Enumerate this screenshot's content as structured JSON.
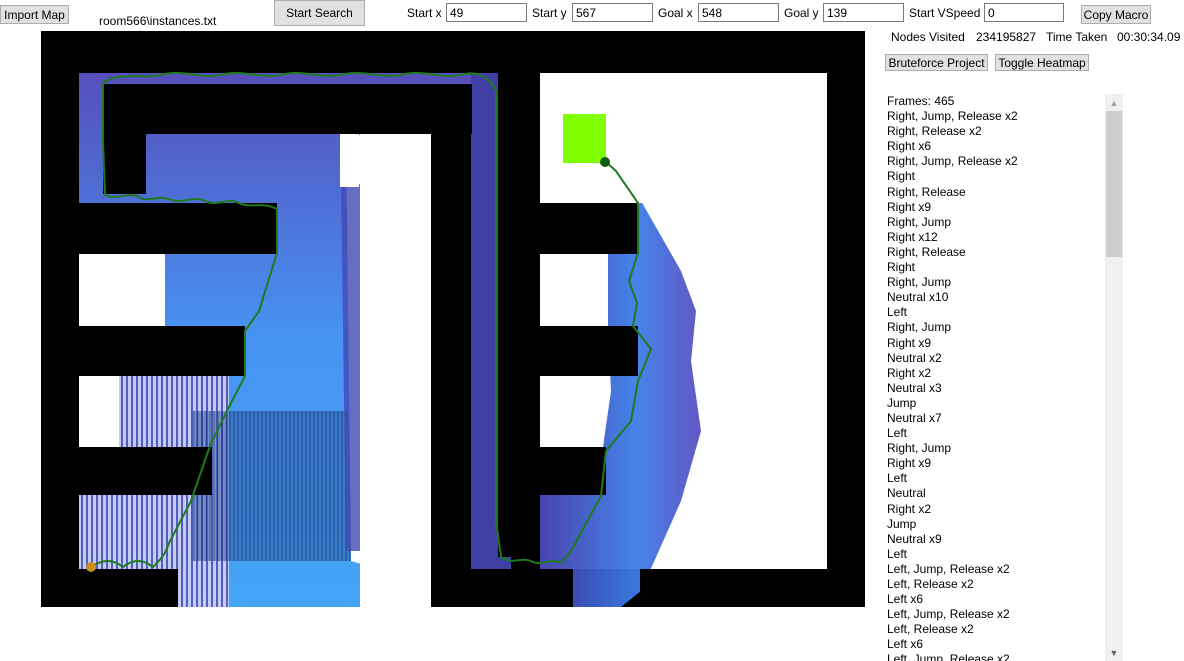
{
  "toolbar": {
    "import_label": "Import Map",
    "file_name": "room566\\instances.txt",
    "start_search_label": "Start Search",
    "start_x_label": "Start x",
    "start_x_value": "49",
    "start_y_label": "Start y",
    "start_y_value": "567",
    "goal_x_label": "Goal x",
    "goal_x_value": "548",
    "goal_y_label": "Goal y",
    "goal_y_value": "139",
    "start_vspeed_label": "Start VSpeed",
    "start_vspeed_value": "0",
    "copy_macro_label": "Copy Macro"
  },
  "stats": {
    "nodes_label": "Nodes Visited",
    "nodes_value": "234195827",
    "time_label": "Time Taken",
    "time_value": "00:30:34.09"
  },
  "side_buttons": {
    "bruteforce_label": "Bruteforce Project",
    "heatmap_label": "Toggle Heatmap"
  },
  "colors": {
    "wall": "#000000",
    "path": "#1f7a1f",
    "goal": "#80ff00",
    "start_marker": "#c89020",
    "end_marker": "#0b5f0b",
    "heat_low": "#4a3fb0",
    "heat_high": "#3a8df0"
  },
  "macro": [
    "Frames: 465",
    "Right, Jump, Release x2",
    "Right, Release x2",
    "Right x6",
    "Right, Jump, Release x2",
    "Right",
    "Right, Release",
    "Right x9",
    "Right, Jump",
    "Right x12",
    "Right, Release",
    "Right",
    "Right, Jump",
    "Neutral x10",
    "Left",
    "Right, Jump",
    "Right x9",
    "Neutral x2",
    "Right x2",
    "Neutral x3",
    "Jump",
    "Neutral x7",
    "Left",
    "Right, Jump",
    "Right x9",
    "Left",
    "Neutral",
    "Right x2",
    "Jump",
    "Neutral x9",
    "Left",
    "Left, Jump, Release x2",
    "Left, Release x2",
    "Left x6",
    "Left, Jump, Release x2",
    "Left, Release x2",
    "Left x6",
    "Left, Jump, Release x2"
  ]
}
